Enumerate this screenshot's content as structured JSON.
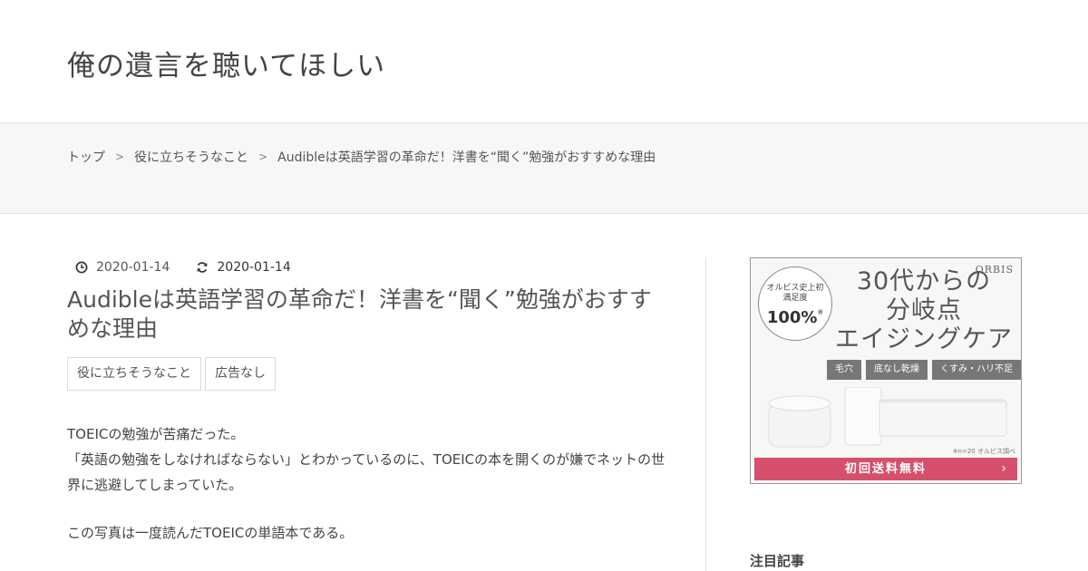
{
  "site": {
    "title": "俺の遺言を聴いてほしい"
  },
  "breadcrumb": {
    "items": [
      "トップ",
      "役に立ちそうなこと",
      "Audibleは英語学習の革命だ！洋書を“聞く”勉強がおすすめな理由"
    ],
    "separator": ">"
  },
  "post": {
    "published": "2020-01-14",
    "updated": "2020-01-14",
    "title": "Audibleは英語学習の革命だ！洋書を“聞く”勉強がおすすめな理由",
    "tags": [
      "役に立ちそうなこと",
      "広告なし"
    ],
    "body": [
      "TOEICの勉強が苦痛だった。",
      "「英語の勉強をしなければならない」とわかっているのに、TOEICの本を開くのが嫌でネットの世界に逃避してしまっていた。",
      "この写真は一度読んだTOEICの単語本である。"
    ]
  },
  "ad": {
    "brand": "ORBIS",
    "badge_line1": "オルビス史上初",
    "badge_line2": "満足度",
    "badge_value": "100%",
    "badge_mark": "※",
    "headline": [
      "30代からの",
      "分岐点",
      "エイジングケア"
    ],
    "chips": [
      "毛穴",
      "底なし乾燥",
      "くすみ・ハリ不足"
    ],
    "note": "※n=20 オルビス調べ",
    "cta": "初回送料無料",
    "cta_arrow": "›",
    "accent_color": "#d64f6c"
  },
  "sidebar": {
    "heading": "注目記事"
  },
  "icons": {
    "published": "clock-icon",
    "updated": "refresh-icon"
  }
}
